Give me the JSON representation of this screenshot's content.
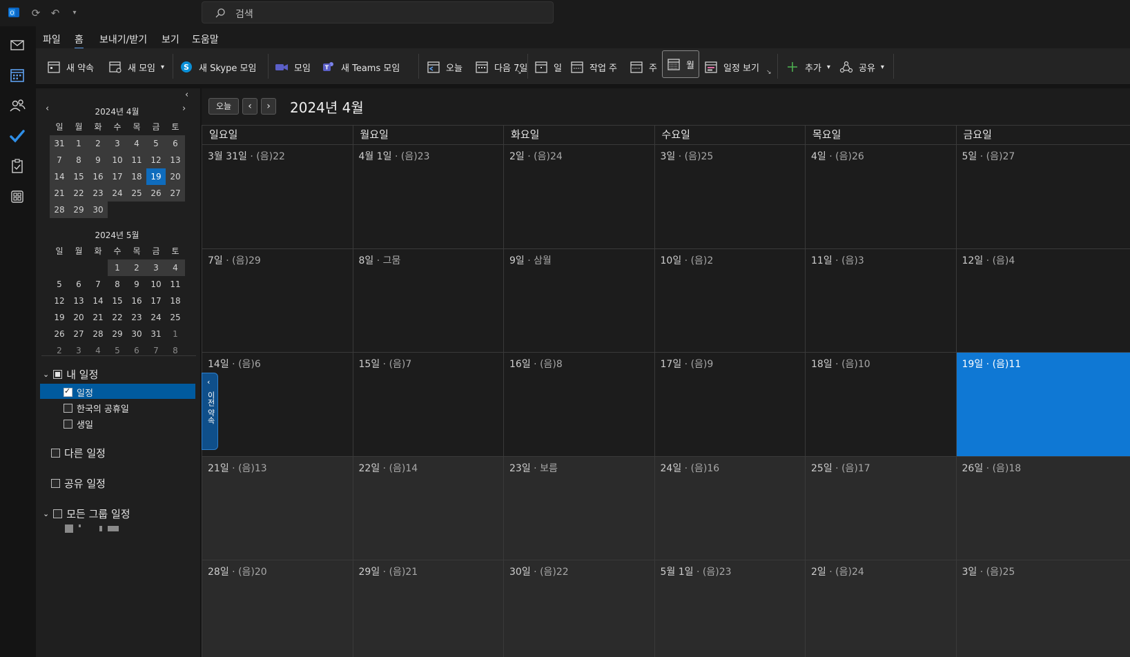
{
  "search": {
    "placeholder": "검색"
  },
  "menu": [
    "파일",
    "홈",
    "보내기/받기",
    "보기",
    "도움말"
  ],
  "menu_active_index": 1,
  "ribbon": {
    "new_appointment": "새 약속",
    "new_meeting": "새 모임",
    "new_skype": "새 Skype 모임",
    "meeting": "모임",
    "new_teams": "새 Teams 모임",
    "today": "오늘",
    "next7": "다음 7일",
    "day": "일",
    "work_week": "작업 주",
    "week": "주",
    "month": "월",
    "schedule_view": "일정 보기",
    "add": "추가",
    "share": "공유"
  },
  "mini_april": {
    "title": "2024년 4월",
    "weekdays": [
      "일",
      "월",
      "화",
      "수",
      "목",
      "금",
      "토"
    ],
    "days": [
      "31",
      "1",
      "2",
      "3",
      "4",
      "5",
      "6",
      "7",
      "8",
      "9",
      "10",
      "11",
      "12",
      "13",
      "14",
      "15",
      "16",
      "17",
      "18",
      "19",
      "20",
      "21",
      "22",
      "23",
      "24",
      "25",
      "26",
      "27",
      "28",
      "29",
      "30"
    ]
  },
  "mini_may": {
    "title": "2024년 5월",
    "weekdays": [
      "일",
      "월",
      "화",
      "수",
      "목",
      "금",
      "토"
    ],
    "days": [
      "",
      "",
      "",
      "1",
      "2",
      "3",
      "4",
      "5",
      "6",
      "7",
      "8",
      "9",
      "10",
      "11",
      "12",
      "13",
      "14",
      "15",
      "16",
      "17",
      "18",
      "19",
      "20",
      "21",
      "22",
      "23",
      "24",
      "25",
      "26",
      "27",
      "28",
      "29",
      "30",
      "31",
      "1",
      "2",
      "3",
      "4",
      "5",
      "6",
      "7",
      "8"
    ]
  },
  "tree": {
    "my_calendars": "내 일정",
    "calendar": "일정",
    "korea_holidays": "한국의 공휴일",
    "birthdays": "생일",
    "other_calendars": "다른 일정",
    "shared_calendars": "공유 일정",
    "all_group_calendars": "모든 그룹 일정"
  },
  "prev_appointment": "이전 약속",
  "calendar": {
    "today_button": "오늘",
    "title": "2024년 4월",
    "weekday_headers": [
      "일요일",
      "월요일",
      "화요일",
      "수요일",
      "목요일",
      "금요일"
    ],
    "weeks": [
      [
        [
          "3월 31일",
          "(음)22"
        ],
        [
          "4월 1일",
          "(음)23"
        ],
        [
          "2일",
          "(음)24"
        ],
        [
          "3일",
          "(음)25"
        ],
        [
          "4일",
          "(음)26"
        ],
        [
          "5일",
          "(음)27"
        ]
      ],
      [
        [
          "7일",
          "(음)29"
        ],
        [
          "8일",
          "그뭄"
        ],
        [
          "9일",
          "삼월"
        ],
        [
          "10일",
          "(음)2"
        ],
        [
          "11일",
          "(음)3"
        ],
        [
          "12일",
          "(음)4"
        ]
      ],
      [
        [
          "14일",
          "(음)6"
        ],
        [
          "15일",
          "(음)7"
        ],
        [
          "16일",
          "(음)8"
        ],
        [
          "17일",
          "(음)9"
        ],
        [
          "18일",
          "(음)10"
        ],
        [
          "19일",
          "(음)11"
        ]
      ],
      [
        [
          "21일",
          "(음)13"
        ],
        [
          "22일",
          "(음)14"
        ],
        [
          "23일",
          "보름"
        ],
        [
          "24일",
          "(음)16"
        ],
        [
          "25일",
          "(음)17"
        ],
        [
          "26일",
          "(음)18"
        ]
      ],
      [
        [
          "28일",
          "(음)20"
        ],
        [
          "29일",
          "(음)21"
        ],
        [
          "30일",
          "(음)22"
        ],
        [
          "5월 1일",
          "(음)23"
        ],
        [
          "2일",
          "(음)24"
        ],
        [
          "3일",
          "(음)25"
        ]
      ]
    ],
    "today_index": [
      2,
      5
    ]
  },
  "colors": {
    "accent": "#0f78d4",
    "today_mini": "#0f6cbd"
  }
}
